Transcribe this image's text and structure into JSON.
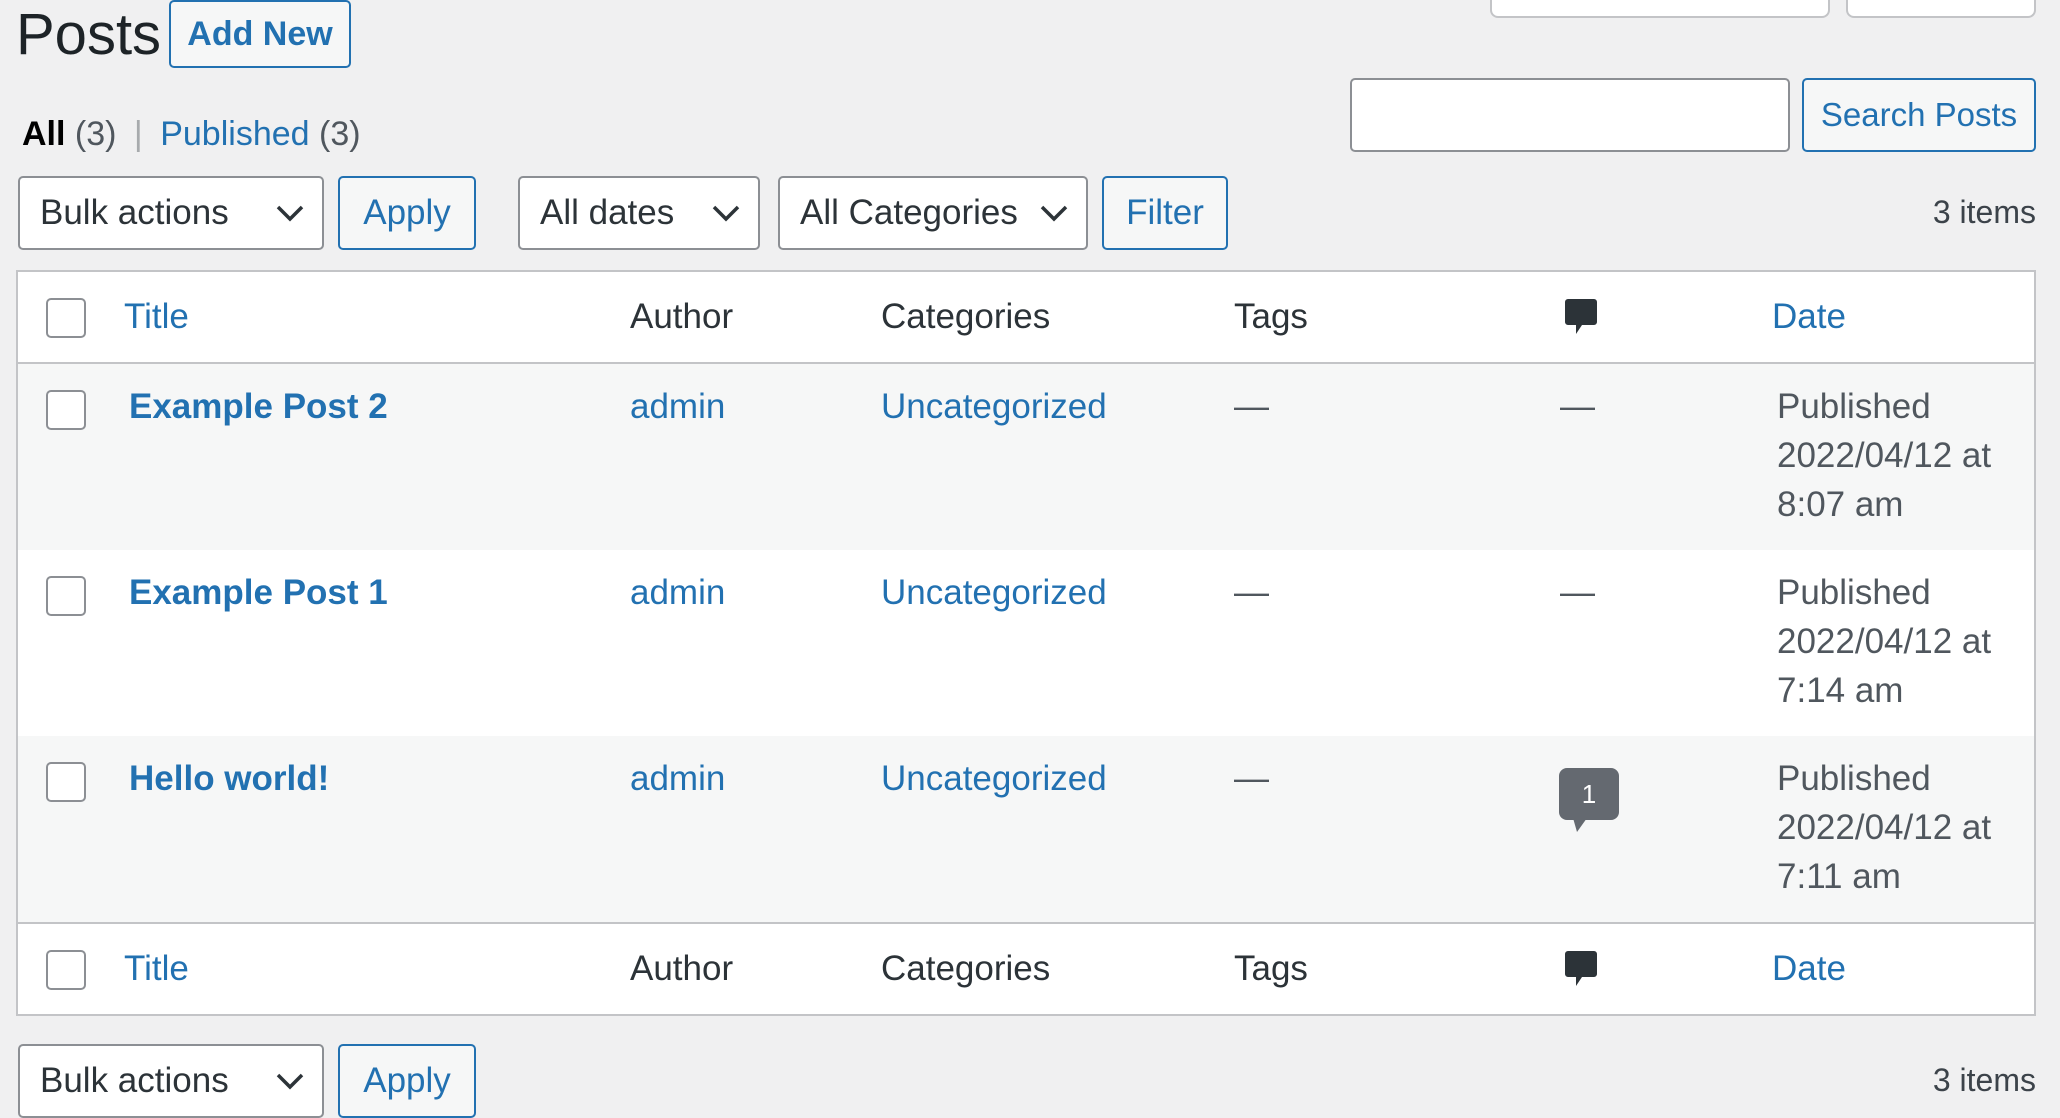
{
  "header": {
    "title": "Posts",
    "add_new": "Add New"
  },
  "views": {
    "all": "All",
    "all_count": "(3)",
    "separator": "|",
    "published": "Published",
    "published_count": "(3)"
  },
  "search": {
    "value": "",
    "button": "Search Posts"
  },
  "tablenav_top": {
    "bulk_actions": "Bulk actions",
    "apply": "Apply",
    "dates": "All dates",
    "categories": "All Categories",
    "filter": "Filter",
    "items": "3 items"
  },
  "table": {
    "columns": {
      "title": "Title",
      "author": "Author",
      "categories": "Categories",
      "tags": "Tags",
      "comments_icon": "comment-bubble-icon",
      "date": "Date"
    },
    "rows": [
      {
        "title": "Example Post 2",
        "author": "admin",
        "category": "Uncategorized",
        "tags": "—",
        "comments": "—",
        "date_status": "Published",
        "date_line": "2022/04/12 at",
        "time": "8:07 am"
      },
      {
        "title": "Example Post 1",
        "author": "admin",
        "category": "Uncategorized",
        "tags": "—",
        "comments": "—",
        "date_status": "Published",
        "date_line": "2022/04/12 at",
        "time": "7:14 am"
      },
      {
        "title": "Hello world!",
        "author": "admin",
        "category": "Uncategorized",
        "tags": "—",
        "comments": "1",
        "date_status": "Published",
        "date_line": "2022/04/12 at",
        "time": "7:11 am"
      }
    ]
  },
  "tablenav_bottom": {
    "bulk_actions": "Bulk actions",
    "apply": "Apply",
    "items": "3 items"
  },
  "colors": {
    "link": "#2271b1",
    "background": "#f0f0f1",
    "border": "#c3c4c7"
  }
}
